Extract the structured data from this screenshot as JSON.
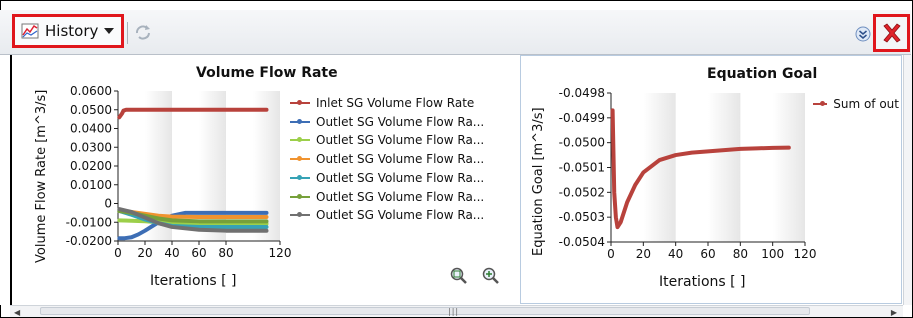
{
  "toolbar": {
    "history_label": "History",
    "history_icon": "chart-history-icon",
    "refresh_icon": "refresh-icon",
    "expand_icon": "expand-icon",
    "close_icon": "close-icon"
  },
  "chart_data": [
    {
      "type": "line",
      "title": "Volume Flow Rate",
      "xlabel": "Iterations [ ]",
      "ylabel": "Volume Flow Rate [m^3/s]",
      "xlim": [
        0,
        120
      ],
      "ylim": [
        -0.02,
        0.06
      ],
      "xticks": [
        "0",
        "20",
        "40",
        "60",
        "80",
        "120"
      ],
      "yticks": [
        "0.0600",
        "0.0500",
        "0.0400",
        "0.0300",
        "0.0200",
        "0.0100",
        "0",
        "-0.0100",
        "-0.0200"
      ],
      "legend": "right",
      "series": [
        {
          "name": "Inlet SG Volume Flow Rate",
          "color": "#b8423c",
          "x": [
            1,
            2,
            3,
            4,
            6,
            10,
            20,
            40,
            60,
            80,
            100,
            110
          ],
          "y": [
            0.046,
            0.047,
            0.048,
            0.0495,
            0.05,
            0.05,
            0.05,
            0.05,
            0.05,
            0.05,
            0.05,
            0.05
          ]
        },
        {
          "name": "Outlet SG Volume Flow Ra...",
          "color": "#3d6eb5",
          "x": [
            1,
            5,
            10,
            15,
            20,
            30,
            40,
            50,
            60,
            80,
            100,
            110
          ],
          "y": [
            -0.0185,
            -0.0185,
            -0.018,
            -0.0165,
            -0.0145,
            -0.01,
            -0.0065,
            -0.005,
            -0.005,
            -0.005,
            -0.005,
            -0.005
          ]
        },
        {
          "name": "Outlet SG Volume Flow Ra...",
          "color": "#9ccf4a",
          "x": [
            1,
            10,
            20,
            30,
            40,
            60,
            80,
            100,
            110
          ],
          "y": [
            -0.009,
            -0.0092,
            -0.0095,
            -0.01,
            -0.0105,
            -0.0108,
            -0.0108,
            -0.0108,
            -0.0108
          ]
        },
        {
          "name": "Outlet SG Volume Flow Ra...",
          "color": "#f0932f",
          "x": [
            1,
            10,
            20,
            30,
            40,
            60,
            80,
            100,
            110
          ],
          "y": [
            -0.004,
            -0.0045,
            -0.0055,
            -0.0065,
            -0.007,
            -0.0072,
            -0.0072,
            -0.0072,
            -0.0072
          ]
        },
        {
          "name": "Outlet SG Volume Flow Ra...",
          "color": "#35a2b5",
          "x": [
            1,
            10,
            20,
            30,
            40,
            60,
            80,
            100,
            110
          ],
          "y": [
            -0.004,
            -0.006,
            -0.0085,
            -0.0105,
            -0.012,
            -0.0125,
            -0.0125,
            -0.0125,
            -0.0125
          ]
        },
        {
          "name": "Outlet SG Volume Flow Ra...",
          "color": "#76a03a",
          "x": [
            1,
            10,
            20,
            30,
            40,
            60,
            80,
            100,
            110
          ],
          "y": [
            -0.004,
            -0.005,
            -0.0065,
            -0.008,
            -0.009,
            -0.0095,
            -0.0095,
            -0.0095,
            -0.0095
          ]
        },
        {
          "name": "Outlet SG Volume Flow Ra...",
          "color": "#707070",
          "x": [
            1,
            10,
            20,
            30,
            40,
            60,
            80,
            100,
            110
          ],
          "y": [
            -0.003,
            -0.0045,
            -0.0075,
            -0.0105,
            -0.0125,
            -0.014,
            -0.0145,
            -0.0145,
            -0.0145
          ]
        }
      ]
    },
    {
      "type": "line",
      "title": "Equation Goal",
      "xlabel": "Iterations [ ]",
      "ylabel": "Equation Goal [m^3/s]",
      "xlim": [
        0,
        120
      ],
      "ylim": [
        -0.0504,
        -0.0498
      ],
      "xticks": [
        "0",
        "20",
        "40",
        "60",
        "80",
        "100",
        "120"
      ],
      "yticks": [
        "-0.0498",
        "-0.0499",
        "-0.0500",
        "-0.0501",
        "-0.0502",
        "-0.0503",
        "-0.0504"
      ],
      "legend": "right",
      "series": [
        {
          "name": "Sum of out",
          "color": "#b8423c",
          "x": [
            1,
            2,
            3,
            4,
            6,
            10,
            15,
            20,
            30,
            40,
            50,
            60,
            70,
            80,
            90,
            100,
            110
          ],
          "y": [
            -0.04987,
            -0.0502,
            -0.0503,
            -0.05034,
            -0.05032,
            -0.05024,
            -0.05017,
            -0.05012,
            -0.05007,
            -0.05005,
            -0.05004,
            -0.050035,
            -0.05003,
            -0.050025,
            -0.050023,
            -0.050021,
            -0.05002
          ]
        }
      ]
    }
  ]
}
